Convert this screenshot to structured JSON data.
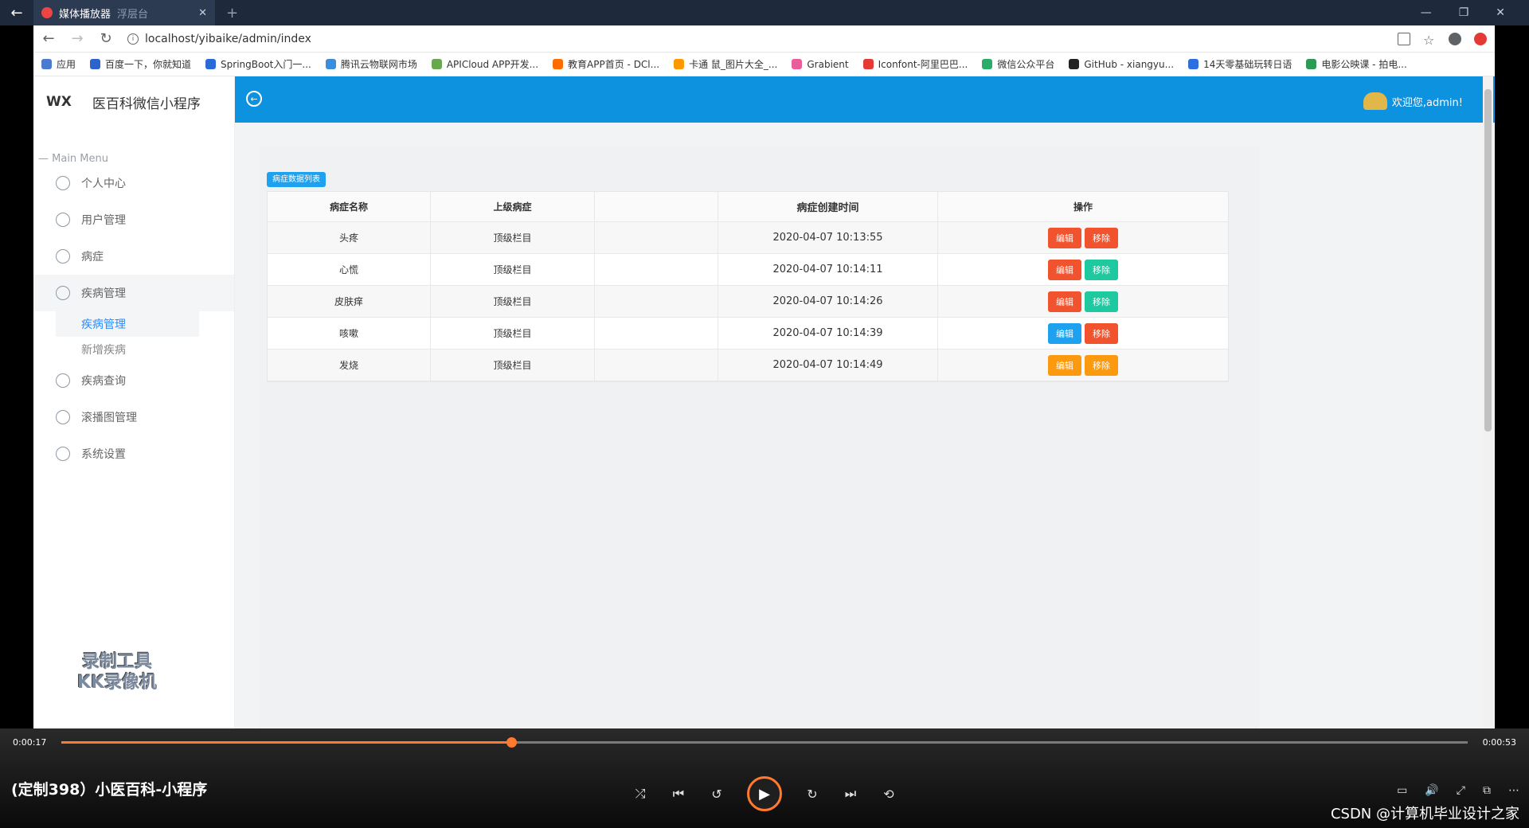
{
  "player": {
    "tab_title": "媒体播放器",
    "tab_suffix": "浮层台",
    "video_title": "(定制398）小医百科-小程序",
    "current_time": "0:00:17",
    "total_time": "0:00:53",
    "progress": 0.32
  },
  "browser": {
    "url": "localhost/yibaike/admin/index",
    "bookmarks": [
      {
        "label": "应用",
        "color": "#4a7bd0"
      },
      {
        "label": "百度一下，你就知道",
        "color": "#2e62cd"
      },
      {
        "label": "SpringBoot入门一...",
        "color": "#2a6ad8"
      },
      {
        "label": "腾讯云物联网市场",
        "color": "#3b8de0"
      },
      {
        "label": "APICloud APP开发...",
        "color": "#6aa84f"
      },
      {
        "label": "教育APP首页 - DCl...",
        "color": "#ff6d00"
      },
      {
        "label": "卡通 鼠_图片大全_...",
        "color": "#ff9800"
      },
      {
        "label": "Grabient",
        "color": "#e85d9a"
      },
      {
        "label": "Iconfont-阿里巴巴...",
        "color": "#e53935"
      },
      {
        "label": "微信公众平台",
        "color": "#2aae67"
      },
      {
        "label": "GitHub - xiangyu...",
        "color": "#222222"
      },
      {
        "label": "14天零基础玩转日语",
        "color": "#2d6ee0"
      },
      {
        "label": "电影公映课 - 拍电...",
        "color": "#2c9a55"
      }
    ]
  },
  "app": {
    "logo_short": "WX",
    "logo_title": "医百科微信小程序",
    "menu_caption": "Main Menu",
    "menu": [
      {
        "label": "个人中心",
        "icon": "shield-icon"
      },
      {
        "label": "用户管理",
        "icon": "user-icon"
      },
      {
        "label": "病症",
        "icon": "info-icon"
      },
      {
        "label": "疾病管理",
        "icon": "thumb-icon"
      }
    ],
    "submenu": [
      {
        "label": "疾病管理"
      },
      {
        "label": "新增疾病"
      }
    ],
    "menu_after": [
      {
        "label": "疾病查询",
        "icon": "image-icon"
      },
      {
        "label": "滚播图管理",
        "icon": "diamond-icon"
      },
      {
        "label": "系统设置",
        "icon": "exit-icon"
      }
    ],
    "welcome": "欢迎您,admin!",
    "watermark_line1": "录制工具",
    "watermark_line2": "KK录像机",
    "list_tag": "病症数据列表",
    "table": {
      "headers": [
        "病症名称",
        "上级病症",
        "",
        "病症创建时间",
        "操作"
      ],
      "rows": [
        {
          "name": "头疼",
          "parent": "顶级栏目",
          "created": "2020-04-07 10:13:55"
        },
        {
          "name": "心慌",
          "parent": "顶级栏目",
          "created": "2020-04-07 10:14:11"
        },
        {
          "name": "皮肤痒",
          "parent": "顶级栏目",
          "created": "2020-04-07 10:14:26"
        },
        {
          "name": "咳嗽",
          "parent": "顶级栏目",
          "created": "2020-04-07 10:14:39"
        },
        {
          "name": "发烧",
          "parent": "顶级栏目",
          "created": "2020-04-07 10:14:49"
        }
      ],
      "edit_label": "编辑",
      "remove_label": "移除"
    },
    "colors": {
      "edit_row1": "#f0532e",
      "remove_row1": "#f0532e",
      "edit_row2": "#f0532e",
      "remove_row2": "#1ec9a0",
      "edit_row3": "#f0532e",
      "remove_row3": "#1ec9a0",
      "edit_row4": "#1ea2f0",
      "remove_row4": "#f0532e",
      "edit_row5": "#fb9a0e",
      "remove_row5": "#fb9a0e"
    }
  },
  "footer": {
    "csdn": "CSDN @计算机毕业设计之家"
  }
}
